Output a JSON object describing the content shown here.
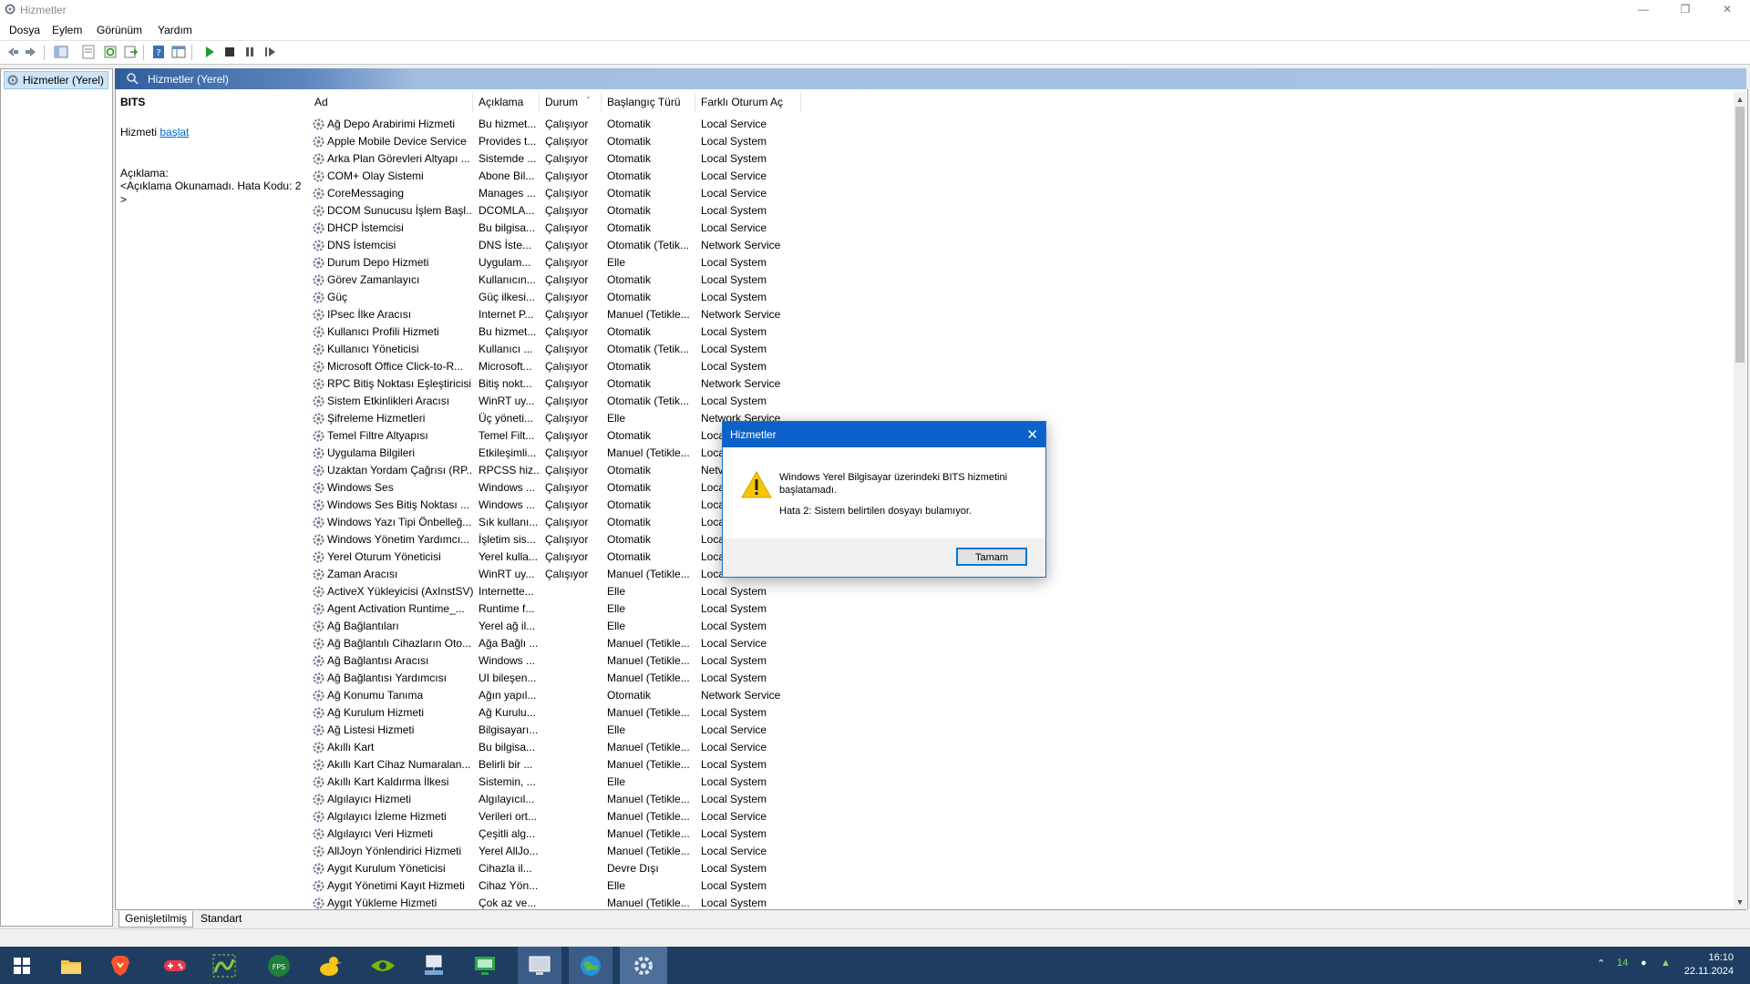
{
  "window": {
    "title": "Hizmetler"
  },
  "menu": [
    "Dosya",
    "Eylem",
    "Görünüm",
    "Yardım"
  ],
  "tree": {
    "root": "Hizmetler (Yerel)"
  },
  "header": {
    "title": "Hizmetler (Yerel)"
  },
  "description_panel": {
    "service_name": "BITS",
    "action_prefix": "Hizmeti ",
    "action_link": "başlat",
    "desc_label": "Açıklama:",
    "desc_text": "<Açıklama Okunamadı. Hata Kodu: 2 >"
  },
  "columns": [
    "Ad",
    "Açıklama",
    "Durum",
    "Başlangıç Türü",
    "Farklı Oturum Aç"
  ],
  "rows": [
    [
      "Ağ Depo Arabirimi Hizmeti",
      "Bu hizmet...",
      "Çalışıyor",
      "Otomatik",
      "Local Service"
    ],
    [
      "Apple Mobile Device Service",
      "Provides t...",
      "Çalışıyor",
      "Otomatik",
      "Local System"
    ],
    [
      "Arka Plan Görevleri Altyapı ...",
      "Sistemde ...",
      "Çalışıyor",
      "Otomatik",
      "Local System"
    ],
    [
      "COM+ Olay Sistemi",
      "Abone Bil...",
      "Çalışıyor",
      "Otomatik",
      "Local Service"
    ],
    [
      "CoreMessaging",
      "Manages ...",
      "Çalışıyor",
      "Otomatik",
      "Local Service"
    ],
    [
      "DCOM Sunucusu İşlem Başl...",
      "DCOMLA...",
      "Çalışıyor",
      "Otomatik",
      "Local System"
    ],
    [
      "DHCP İstemcisi",
      "Bu bilgisa...",
      "Çalışıyor",
      "Otomatik",
      "Local Service"
    ],
    [
      "DNS İstemcisi",
      "DNS İste...",
      "Çalışıyor",
      "Otomatik (Tetik...",
      "Network Service"
    ],
    [
      "Durum Depo Hizmeti",
      "Uygulam...",
      "Çalışıyor",
      "Elle",
      "Local System"
    ],
    [
      "Görev Zamanlayıcı",
      "Kullanıcın...",
      "Çalışıyor",
      "Otomatik",
      "Local System"
    ],
    [
      "Güç",
      "Güç ilkesi...",
      "Çalışıyor",
      "Otomatik",
      "Local System"
    ],
    [
      "IPsec İlke Aracısı",
      "Internet P...",
      "Çalışıyor",
      "Manuel (Tetikle...",
      "Network Service"
    ],
    [
      "Kullanıcı Profili Hizmeti",
      "Bu hizmet...",
      "Çalışıyor",
      "Otomatik",
      "Local System"
    ],
    [
      "Kullanıcı Yöneticisi",
      "Kullanıcı ...",
      "Çalışıyor",
      "Otomatik (Tetik...",
      "Local System"
    ],
    [
      "Microsoft Office Click-to-R...",
      "Microsoft...",
      "Çalışıyor",
      "Otomatik",
      "Local System"
    ],
    [
      "RPC Bitiş Noktası Eşleştiricisi",
      "Bitiş nokt...",
      "Çalışıyor",
      "Otomatik",
      "Network Service"
    ],
    [
      "Sistem Etkinlikleri Aracısı",
      "WinRT uy...",
      "Çalışıyor",
      "Otomatik (Tetik...",
      "Local System"
    ],
    [
      "Şifreleme Hizmetleri",
      "Üç yöneti...",
      "Çalışıyor",
      "Elle",
      "Network Service"
    ],
    [
      "Temel Filtre Altyapısı",
      "Temel Filt...",
      "Çalışıyor",
      "Otomatik",
      "Loca"
    ],
    [
      "Uygulama Bilgileri",
      "Etkileşimli...",
      "Çalışıyor",
      "Manuel (Tetikle...",
      "Loca"
    ],
    [
      "Uzaktan Yordam Çağrısı (RP...",
      "RPCSS hiz...",
      "Çalışıyor",
      "Otomatik",
      "Netv"
    ],
    [
      "Windows Ses",
      "Windows ...",
      "Çalışıyor",
      "Otomatik",
      "Loca"
    ],
    [
      "Windows Ses Bitiş Noktası ...",
      "Windows ...",
      "Çalışıyor",
      "Otomatik",
      "Loca"
    ],
    [
      "Windows Yazı Tipi Önbelleğ...",
      "Sık kullanı...",
      "Çalışıyor",
      "Otomatik",
      "Loca"
    ],
    [
      "Windows Yönetim Yardımcı...",
      "İşletim sis...",
      "Çalışıyor",
      "Otomatik",
      "Loca"
    ],
    [
      "Yerel Oturum Yöneticisi",
      "Yerel kulla...",
      "Çalışıyor",
      "Otomatik",
      "Loca"
    ],
    [
      "Zaman Aracısı",
      "WinRT uy...",
      "Çalışıyor",
      "Manuel (Tetikle...",
      "Loca"
    ],
    [
      "ActiveX Yükleyicisi (AxInstSV)",
      "Internette...",
      "",
      "Elle",
      "Local System"
    ],
    [
      "Agent Activation Runtime_...",
      "Runtime f...",
      "",
      "Elle",
      "Local System"
    ],
    [
      "Ağ Bağlantıları",
      "Yerel ağ il...",
      "",
      "Elle",
      "Local System"
    ],
    [
      "Ağ Bağlantılı Cihazların Oto...",
      "Ağa Bağlı ...",
      "",
      "Manuel (Tetikle...",
      "Local Service"
    ],
    [
      "Ağ Bağlantısı Aracısı",
      "Windows ...",
      "",
      "Manuel (Tetikle...",
      "Local System"
    ],
    [
      "Ağ Bağlantısı Yardımcısı",
      "UI bileşen...",
      "",
      "Manuel (Tetikle...",
      "Local System"
    ],
    [
      "Ağ Konumu Tanıma",
      "Ağın yapıl...",
      "",
      "Otomatik",
      "Network Service"
    ],
    [
      "Ağ Kurulum Hizmeti",
      "Ağ Kurulu...",
      "",
      "Manuel (Tetikle...",
      "Local System"
    ],
    [
      "Ağ Listesi Hizmeti",
      "Bilgisayarı...",
      "",
      "Elle",
      "Local Service"
    ],
    [
      "Akıllı Kart",
      "Bu bilgisa...",
      "",
      "Manuel (Tetikle...",
      "Local Service"
    ],
    [
      "Akıllı Kart Cihaz Numaralan...",
      "Belirli bir ...",
      "",
      "Manuel (Tetikle...",
      "Local System"
    ],
    [
      "Akıllı Kart Kaldırma İlkesi",
      "Sistemin, ...",
      "",
      "Elle",
      "Local System"
    ],
    [
      "Algılayıcı Hizmeti",
      "Algılayıcıl...",
      "",
      "Manuel (Tetikle...",
      "Local System"
    ],
    [
      "Algılayıcı İzleme Hizmeti",
      "Verileri ort...",
      "",
      "Manuel (Tetikle...",
      "Local Service"
    ],
    [
      "Algılayıcı Veri Hizmeti",
      "Çeşitli alg...",
      "",
      "Manuel (Tetikle...",
      "Local System"
    ],
    [
      "AllJoyn Yönlendirici Hizmeti",
      "Yerel AllJo...",
      "",
      "Manuel (Tetikle...",
      "Local Service"
    ],
    [
      "Aygıt Kurulum Yöneticisi",
      "Cihazla il...",
      "",
      "Devre Dışı",
      "Local System"
    ],
    [
      "Aygıt Yönetimi Kayıt Hizmeti",
      "Cihaz Yön...",
      "",
      "Elle",
      "Local System"
    ],
    [
      "Aygıt Yükleme Hizmeti",
      "Çok az ve...",
      "",
      "Manuel (Tetikle...",
      "Local System"
    ]
  ],
  "tabs": [
    "Genişletilmiş",
    "Standart"
  ],
  "dialog": {
    "title": "Hizmetler",
    "message": "Windows Yerel Bilgisayar üzerindeki BITS hizmetini başlatamadı.",
    "error": "Hata 2: Sistem belirtilen dosyayı bulamıyor.",
    "ok_label": "Tamam",
    "icon": "warning-icon"
  },
  "taskbar": {
    "apps": [
      "start-icon",
      "file-explorer-icon",
      "brave-browser-icon",
      "game-controller-icon",
      "snake-app-icon",
      "fps-monitor-icon",
      "duck-app-icon",
      "nvidia-icon",
      "network-tool-icon",
      "remote-desktop-icon",
      "system-monitor-icon",
      "globe-app-icon",
      "services-gear-icon"
    ],
    "tray_count": "14",
    "time": "16:10",
    "date": "22.11.2024"
  },
  "colors": {
    "accent": "#0d62c9",
    "header_start": "#2f5e9c",
    "header_end": "#a7c2e2",
    "taskbar": "#1f3d60"
  }
}
